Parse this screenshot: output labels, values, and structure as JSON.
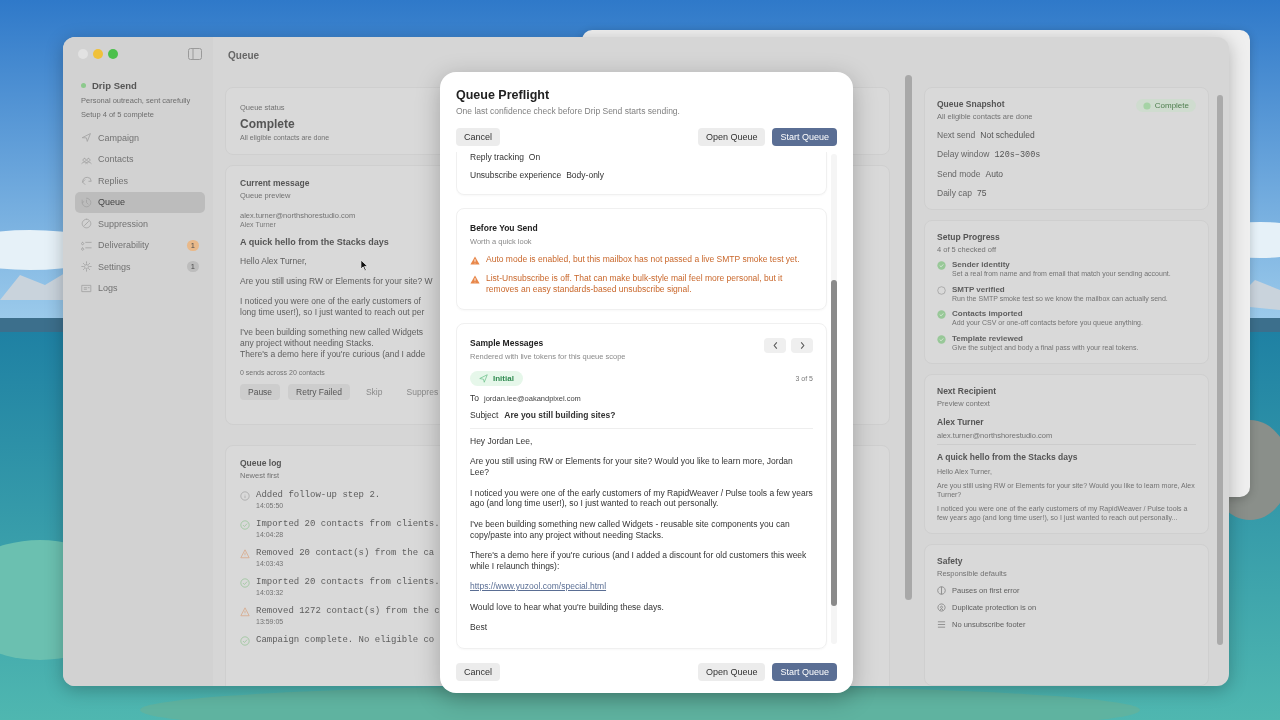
{
  "window": {
    "title": "Queue"
  },
  "sidebar": {
    "app_name": "Drip Send",
    "tagline": "Personal outreach, sent carefully",
    "setup": "Setup 4 of 5 complete",
    "items": [
      {
        "label": "Campaign",
        "selected": false
      },
      {
        "label": "Contacts",
        "selected": false
      },
      {
        "label": "Replies",
        "selected": false
      },
      {
        "label": "Queue",
        "selected": true
      },
      {
        "label": "Suppression",
        "selected": false
      },
      {
        "label": "Deliverability",
        "selected": false,
        "badge": {
          "text": "1",
          "color": "#e9b98a"
        }
      },
      {
        "label": "Settings",
        "selected": false,
        "badge": {
          "text": "1",
          "color": "#bdbdbd"
        }
      },
      {
        "label": "Logs",
        "selected": false
      }
    ]
  },
  "status_card": {
    "label": "Queue status",
    "value": "Complete",
    "note": "All eligible contacts are done"
  },
  "message_card": {
    "title": "Current message",
    "subtitle": "Queue preview",
    "email": "alex.turner@northshorestudio.com",
    "name": "Alex Turner",
    "subject": "A quick hello from the Stacks days",
    "paragraphs": [
      [
        "Hello Alex Turner,"
      ],
      [
        "Are you still using RW or Elements for your site? W"
      ],
      [
        "I noticed you were one of the early customers of",
        "long time user!), so I just wanted to reach out per"
      ],
      [
        "I've been building something new called Widgets",
        "any project without needing Stacks.",
        "There's a demo here if you're curious (and I adde"
      ]
    ],
    "footer": "0 sends across 20 contacts",
    "actions": [
      {
        "label": "Pause",
        "disabled": false
      },
      {
        "label": "Retry Failed",
        "disabled": false
      },
      {
        "label": "Skip",
        "disabled": true
      },
      {
        "label": "Suppres",
        "disabled": true
      }
    ]
  },
  "queue_log": {
    "title": "Queue log",
    "subtitle": "Newest first",
    "entries": [
      {
        "kind": "info",
        "text": "Added follow-up step 2.",
        "time": "14:05:50"
      },
      {
        "kind": "success",
        "text": "Imported 20 contacts from clients.",
        "time": "14:04:28"
      },
      {
        "kind": "warning",
        "text": "Removed 20 contact(s) from the ca",
        "time": "14:03:43"
      },
      {
        "kind": "success",
        "text": "Imported 20 contacts from clients.",
        "time": "14:03:32"
      },
      {
        "kind": "warning",
        "text": "Removed 1272 contact(s) from the c",
        "time": "13:59:05"
      },
      {
        "kind": "success",
        "text": "Campaign complete. No eligible co"
      }
    ]
  },
  "snapshot": {
    "title": "Queue Snapshot",
    "subtitle": "All eligible contacts are done",
    "badge": "Complete",
    "facts": [
      {
        "label": "Next send",
        "value": "Not scheduled",
        "kind": "text"
      },
      {
        "label": "Delay window",
        "value": "120s–300s",
        "kind": "code"
      },
      {
        "label": "Send mode",
        "value": "Auto",
        "kind": "text"
      },
      {
        "label": "Daily cap",
        "value": "75",
        "kind": "text"
      }
    ]
  },
  "setup_progress": {
    "title": "Setup Progress",
    "subtitle": "4 of 5 checked off",
    "steps": [
      {
        "title": "Sender identity",
        "description": "Set a real from name and from email that match your sending account.",
        "checked": true
      },
      {
        "title": "SMTP verified",
        "description": "Run the SMTP smoke test so we know the mailbox can actually send.",
        "checked": false
      },
      {
        "title": "Contacts imported",
        "description": "Add your CSV or one-off contacts before you queue anything.",
        "checked": true
      },
      {
        "title": "Template reviewed",
        "description": "Give the subject and body a final pass with your real tokens.",
        "checked": true
      }
    ]
  },
  "next_recipient": {
    "title": "Next Recipient",
    "subtitle": "Preview context",
    "name": "Alex Turner",
    "email": "alex.turner@northshorestudio.com",
    "subject": "A quick hello from the Stacks days",
    "paragraphs": [
      "Hello Alex Turner,",
      "Are you still using RW or Elements for your site? Would you like to learn more, Alex Turner?",
      "I noticed you were one of the early customers of my RapidWeaver / Pulse tools a few years ago (and long time user!), so I just wanted to reach out personally..."
    ]
  },
  "safety": {
    "title": "Safety",
    "subtitle": "Responsible defaults",
    "items": [
      "Pauses on first error",
      "Duplicate protection is on",
      "No unsubscribe footer"
    ]
  },
  "modal": {
    "title": "Queue Preflight",
    "subtitle": "One last confidence check before Drip Send starts sending.",
    "header_buttons": [
      {
        "label": "Cancel",
        "kind": "plain"
      },
      {
        "label": "Open Queue",
        "kind": "secondary"
      },
      {
        "label": "Start Queue",
        "kind": "primary"
      }
    ],
    "settings": [
      {
        "label": "Reply tracking",
        "value": "On"
      },
      {
        "label": "Unsubscribe experience",
        "value": "Body-only"
      }
    ],
    "before_send": {
      "title": "Before You Send",
      "subtitle": "Worth a quick look",
      "warnings": [
        "Auto mode is enabled, but this mailbox has not passed a live SMTP smoke test yet.",
        "List-Unsubscribe is off. That can make bulk-style mail feel more personal, but it removes an easy standards-based unsubscribe signal."
      ]
    },
    "samples": {
      "title": "Sample Messages",
      "subtitle": "Rendered with live tokens for this queue scope",
      "tag": "Initial",
      "counter": "3 of 5",
      "to_label": "To",
      "to": "jordan.lee@oakandpixel.com",
      "subject_label": "Subject",
      "subject": "Are you still building sites?",
      "body": [
        {
          "kind": "text",
          "text": "Hey Jordan Lee,"
        },
        {
          "kind": "text",
          "text": "Are you still using RW or Elements for your site? Would you like to learn more, Jordan Lee?"
        },
        {
          "kind": "text",
          "text": "I noticed you were one of the early customers of my RapidWeaver / Pulse tools a few years ago (and long time user!), so I just wanted to reach out personally."
        },
        {
          "kind": "text",
          "text": "I've been building something new called Widgets - reusable site components you can copy/paste into any project without needing Stacks."
        },
        {
          "kind": "text",
          "text": "There's a demo here if you're curious (and I added a discount for old customers this week while I relaunch things):"
        },
        {
          "kind": "link",
          "text": "https://www.yuzool.com/special.html"
        },
        {
          "kind": "text",
          "text": "Would love to hear what you're building these days."
        },
        {
          "kind": "text",
          "text": "Best"
        }
      ]
    },
    "footer_buttons": [
      {
        "label": "Cancel",
        "kind": "plain"
      },
      {
        "label": "Open Queue",
        "kind": "secondary"
      },
      {
        "label": "Start Queue",
        "kind": "primary"
      }
    ]
  }
}
